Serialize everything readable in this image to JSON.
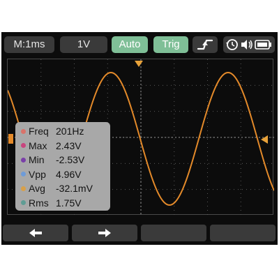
{
  "toolbar": {
    "timebase": "M:1ms",
    "volts_div": "1V",
    "auto_label": "Auto",
    "trig_label": "Trig"
  },
  "measurements": [
    {
      "label": "Freq",
      "value": "201Hz",
      "color": "#d9736a"
    },
    {
      "label": "Max",
      "value": "2.43V",
      "color": "#c8457e"
    },
    {
      "label": "Min",
      "value": "-2.53V",
      "color": "#7a3fa8"
    },
    {
      "label": "Vpp",
      "value": "4.96V",
      "color": "#6e9bd8"
    },
    {
      "label": "Avg",
      "value": "-32.1mV",
      "color": "#d8a04a"
    },
    {
      "label": "Rms",
      "value": "1.75V",
      "color": "#5f9c94"
    }
  ],
  "bottom_buttons": [
    {
      "icon": "arrow-left-icon"
    },
    {
      "icon": "arrow-right-icon"
    },
    {
      "icon": ""
    },
    {
      "icon": ""
    }
  ],
  "status": {
    "icons": [
      "history-icon",
      "speaker-icon",
      "battery-icon"
    ]
  },
  "colors": {
    "accent": "#7fbf97",
    "waveform": "#e48a2a",
    "trigger_marker": "#e8a23a",
    "screen_bg": "#0c0c0c",
    "button_bg": "#3a3a3a"
  }
}
